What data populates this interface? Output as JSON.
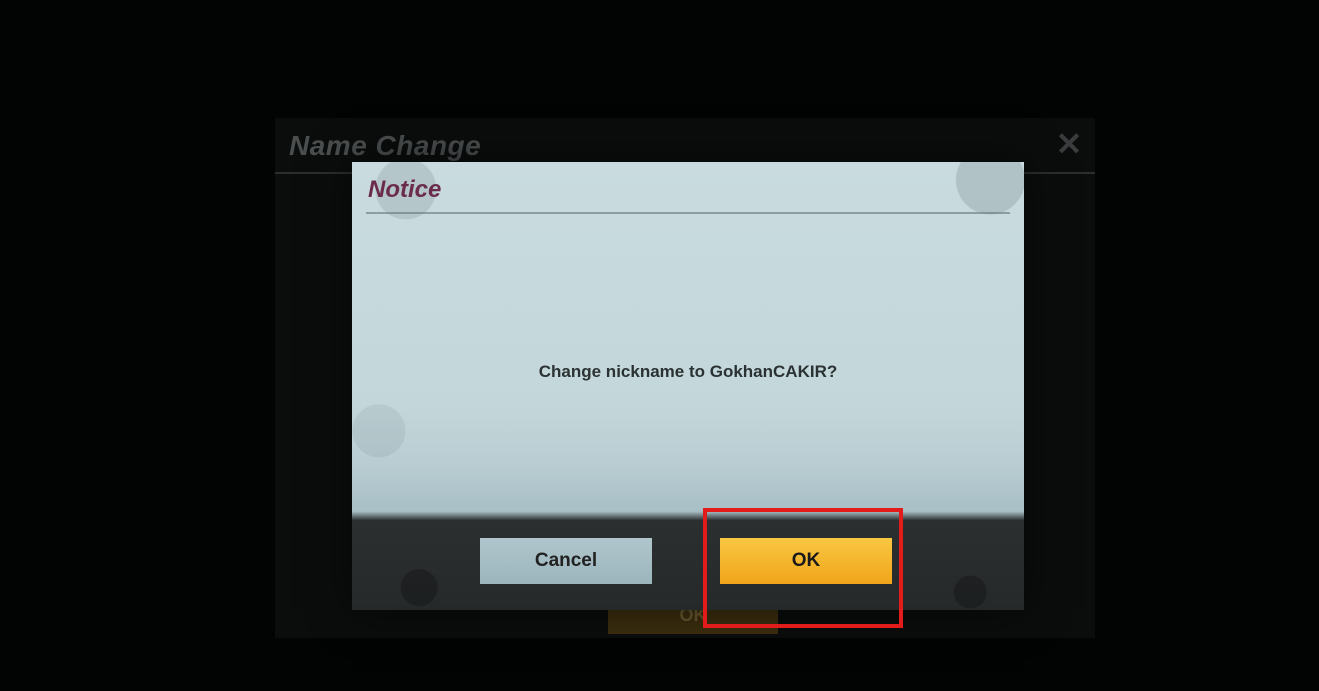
{
  "back_dialog": {
    "title": "Name Change",
    "close_label": "✕",
    "ok_label": "OK"
  },
  "notice": {
    "title": "Notice",
    "message": "Change nickname to GokhanCAKIR?",
    "cancel_label": "Cancel",
    "ok_label": "OK"
  },
  "colors": {
    "highlight": "#e21b1b",
    "accent": "#f5b52a"
  }
}
